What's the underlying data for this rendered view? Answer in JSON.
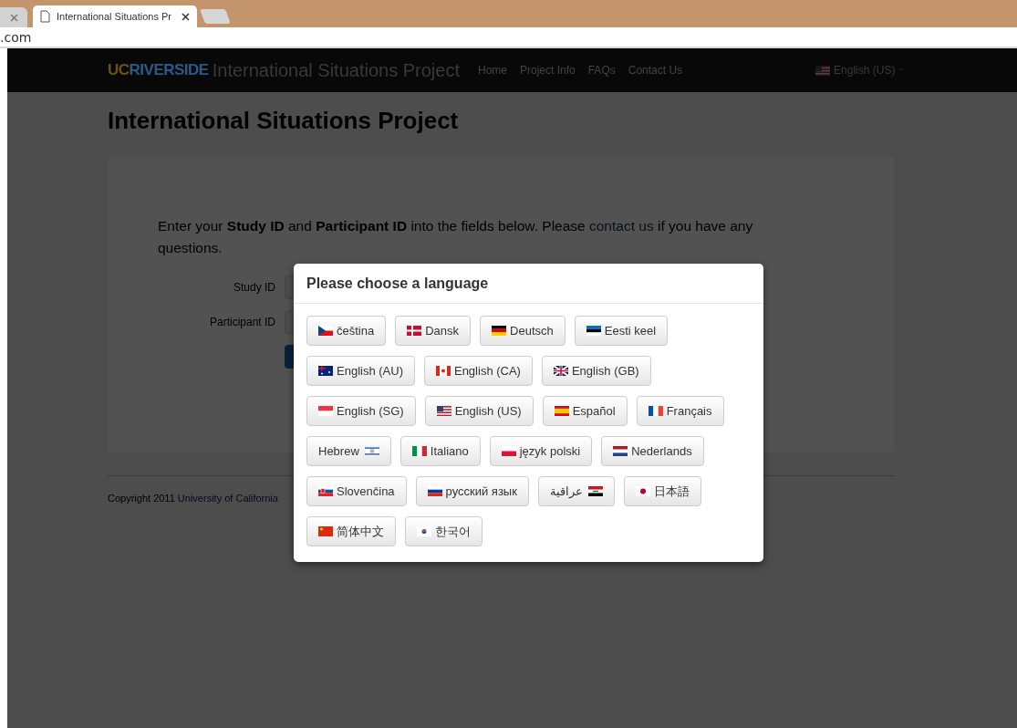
{
  "browser": {
    "tab_title": "International Situations Pr",
    "address": ".com"
  },
  "navbar": {
    "logo": {
      "part_1": "UC",
      "part_2": "RIVERSIDE"
    },
    "brand": "International Situations Project",
    "links": [
      "Home",
      "Project Info",
      "FAQs",
      "Contact Us"
    ],
    "language": {
      "kind": "us",
      "label": "English (US)"
    }
  },
  "page": {
    "heading": "International Situations Project",
    "intro": {
      "text": "Enter your **Study ID** and **Participant ID** into the fields below. Please ",
      "link": "contact us",
      "text_after": " if you have any questions."
    },
    "fields": [
      {
        "label": "Study ID"
      },
      {
        "label": "Participant ID"
      }
    ]
  },
  "footer": {
    "text": "Copyright 2011",
    "link": "University of California"
  },
  "modal": {
    "title": "Please choose a language",
    "languages": [
      {
        "label": "čeština",
        "kind": "cz",
        "flag_after": false
      },
      {
        "label": "Dansk",
        "kind": "dk",
        "flag_after": false
      },
      {
        "label": "Deutsch",
        "kind": "de",
        "flag_after": false
      },
      {
        "label": "Eesti keel",
        "kind": "ee",
        "flag_after": false
      },
      {
        "label": "English (AU)",
        "kind": "au",
        "flag_after": false
      },
      {
        "label": "English (CA)",
        "kind": "ca",
        "flag_after": false
      },
      {
        "label": "English (GB)",
        "kind": "gb",
        "flag_after": false
      },
      {
        "label": "English (SG)",
        "kind": "sg",
        "flag_after": false
      },
      {
        "label": "English (US)",
        "kind": "us",
        "flag_after": false
      },
      {
        "label": "Español",
        "kind": "es",
        "flag_after": false
      },
      {
        "label": "Français",
        "kind": "fr",
        "flag_after": false
      },
      {
        "label": "Hebrew",
        "kind": "il",
        "flag_after": true
      },
      {
        "label": "Italiano",
        "kind": "it",
        "flag_after": false
      },
      {
        "label": "język polski",
        "kind": "pl",
        "flag_after": false
      },
      {
        "label": "Nederlands",
        "kind": "nl",
        "flag_after": false
      },
      {
        "label": "Slovenčina",
        "kind": "sk",
        "flag_after": false
      },
      {
        "label": "русский язык",
        "kind": "ru",
        "flag_after": false
      },
      {
        "label": "عراقية",
        "kind": "iq",
        "flag_after": true
      },
      {
        "label": "日本語",
        "kind": "jp",
        "flag_after": false
      },
      {
        "label": "简体中文",
        "kind": "cn",
        "flag_after": false
      },
      {
        "label": "한국어",
        "kind": "kr",
        "flag_after": false
      }
    ]
  }
}
